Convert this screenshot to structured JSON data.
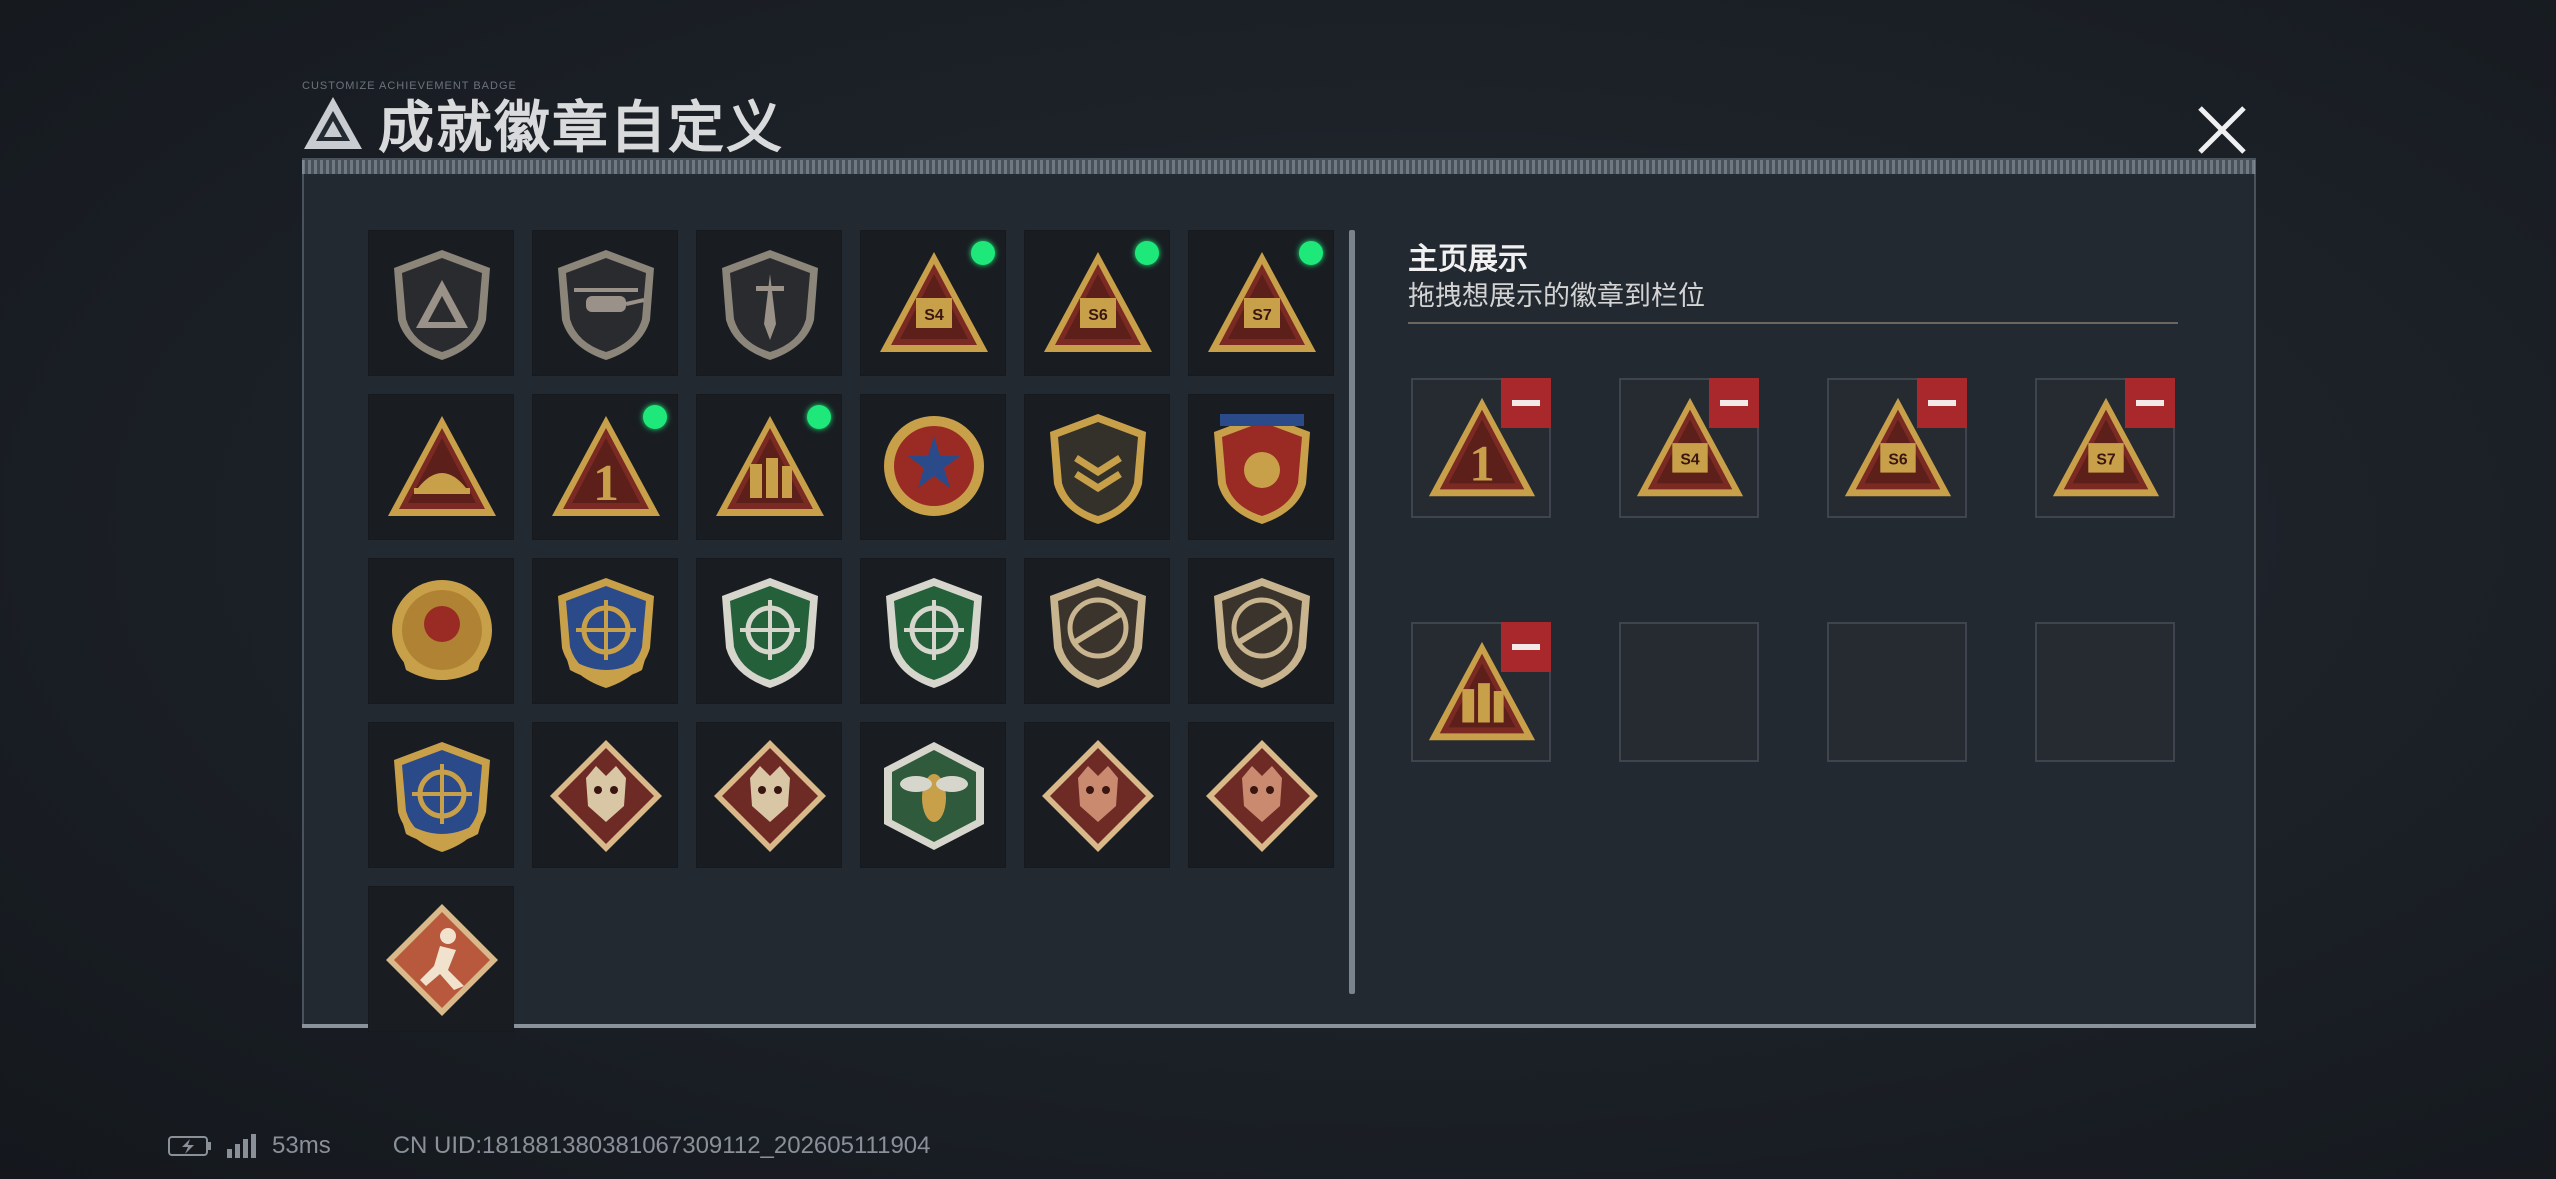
{
  "header": {
    "title": "成就徽章自定义",
    "micro_text": "CUSTOMIZE ACHIEVEMENT BADGE"
  },
  "display": {
    "title": "主页展示",
    "subtitle": "拖拽想展示的徽章到栏位"
  },
  "colors": {
    "accent_new": "#1ee87a",
    "remove": "#a8282b",
    "gold": "#c9a04a"
  },
  "badges": [
    {
      "icon": "triangle-logo-shield-badge-icon",
      "new": false
    },
    {
      "icon": "helicopter-shield-badge-icon",
      "new": false
    },
    {
      "icon": "dagger-shield-badge-icon",
      "new": false
    },
    {
      "icon": "s4-triangle-badge-icon",
      "new": true
    },
    {
      "icon": "s6-triangle-badge-icon",
      "new": true
    },
    {
      "icon": "s7-triangle-badge-icon",
      "new": true
    },
    {
      "icon": "helmet-triangle-badge-icon",
      "new": false
    },
    {
      "icon": "number-one-triangle-badge-icon",
      "new": true
    },
    {
      "icon": "soldiers-triangle-badge-icon",
      "new": true
    },
    {
      "icon": "star-medal-badge-icon",
      "new": false
    },
    {
      "icon": "chevron-shield-badge-icon",
      "new": false
    },
    {
      "icon": "laurel-crest-badge-icon",
      "new": false
    },
    {
      "icon": "gold-emblem-badge-icon",
      "new": false
    },
    {
      "icon": "crosshair-gold-shield-badge-icon",
      "new": false
    },
    {
      "icon": "crosshair-green-shield-badge-icon",
      "new": false
    },
    {
      "icon": "crosshair-green-shield-2-badge-icon",
      "new": false
    },
    {
      "icon": "rifle-bronze-shield-badge-icon",
      "new": false
    },
    {
      "icon": "rifle-bronze-shield-2-badge-icon",
      "new": false
    },
    {
      "icon": "crosshair-blue-gold-shield-badge-icon",
      "new": false
    },
    {
      "icon": "wolf-diamond-badge-icon",
      "new": false
    },
    {
      "icon": "wolf-diamond-2-badge-icon",
      "new": false
    },
    {
      "icon": "wasp-hexagon-badge-icon",
      "new": false
    },
    {
      "icon": "dragon-diamond-badge-icon",
      "new": false
    },
    {
      "icon": "dragon-diamond-2-badge-icon",
      "new": false
    },
    {
      "icon": "runner-diamond-badge-icon",
      "new": false
    }
  ],
  "slots": [
    {
      "icon": "number-one-triangle-badge-icon",
      "filled": true
    },
    {
      "icon": "s4-triangle-badge-icon",
      "filled": true
    },
    {
      "icon": "s6-triangle-badge-icon",
      "filled": true
    },
    {
      "icon": "s7-triangle-badge-icon",
      "filled": true
    },
    {
      "icon": "soldiers-triangle-badge-icon",
      "filled": true
    },
    {
      "icon": "",
      "filled": false
    },
    {
      "icon": "",
      "filled": false
    },
    {
      "icon": "",
      "filled": false
    }
  ],
  "status": {
    "ping": "53ms",
    "uid": "CN UID:181881380381067309112_202605111904"
  }
}
